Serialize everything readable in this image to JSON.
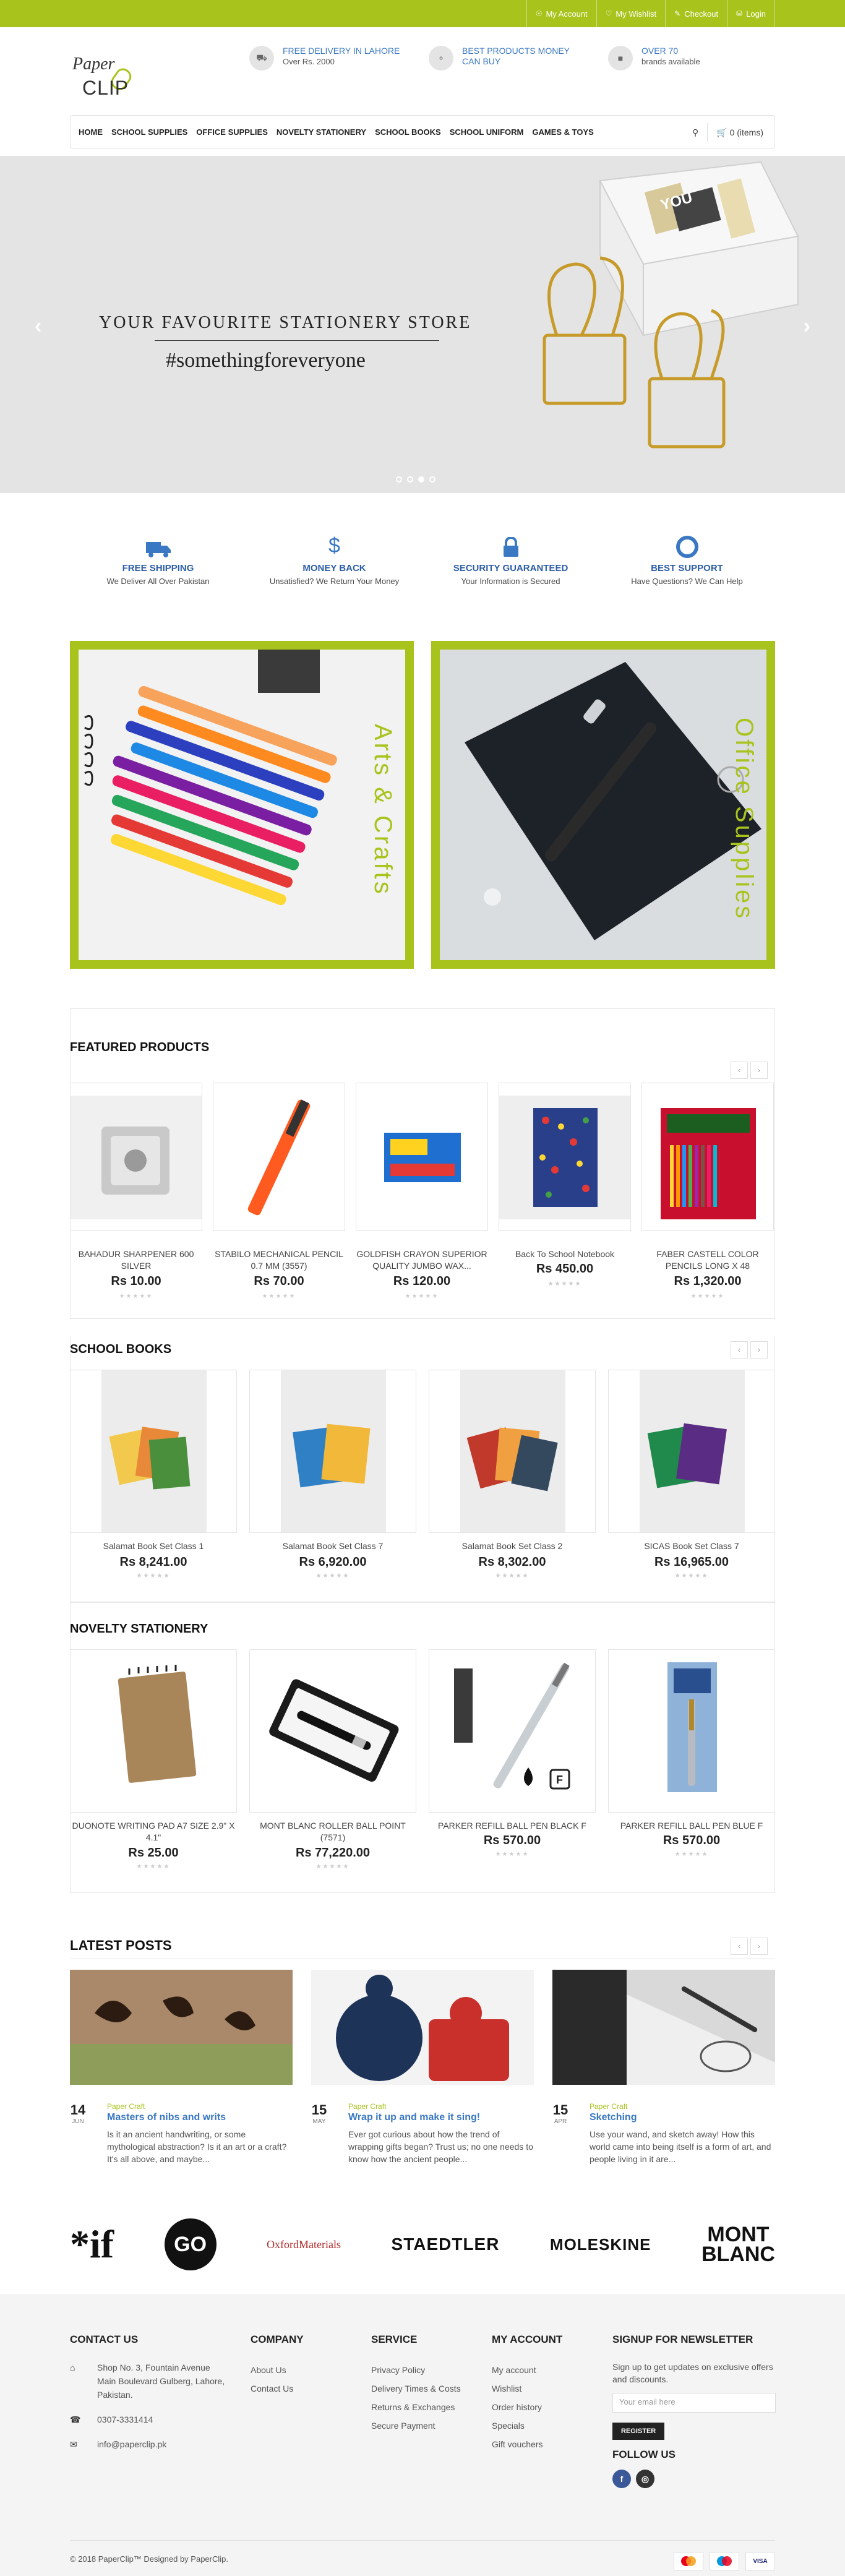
{
  "topbar": {
    "links": [
      {
        "label": "My Account",
        "icon": "user-icon"
      },
      {
        "label": "My Wishlist",
        "icon": "heart-icon"
      },
      {
        "label": "Checkout",
        "icon": "checkout-icon"
      },
      {
        "label": "Login",
        "icon": "lock-icon"
      }
    ]
  },
  "header": {
    "logo": {
      "line1": "Paper",
      "line2": "CLIP"
    },
    "promos": [
      {
        "title": "FREE DELIVERY IN LAHORE",
        "sub": "Over Rs. 2000",
        "icon": "truck-icon"
      },
      {
        "title": "BEST PRODUCTS MONEY CAN BUY",
        "sub": "",
        "icon": "tag-icon"
      },
      {
        "title": "OVER 70",
        "sub": "brands available",
        "icon": "lock-icon"
      }
    ]
  },
  "nav": {
    "items": [
      "HOME",
      "SCHOOL SUPPLIES",
      "OFFICE SUPPLIES",
      "NOVELTY STATIONERY",
      "SCHOOL BOOKS",
      "SCHOOL UNIFORM",
      "GAMES & TOYS"
    ],
    "cart": "0 (items)"
  },
  "hero": {
    "title": "YOUR FAVOURITE STATIONERY STORE",
    "subtitle": "#somethingforeveryone",
    "label": "YOU"
  },
  "features": [
    {
      "title": "FREE SHIPPING",
      "sub": "We Deliver All Over Pakistan",
      "icon": "truck-icon"
    },
    {
      "title": "MONEY BACK",
      "sub": "Unsatisfied? We Return Your Money",
      "icon": "dollar-icon"
    },
    {
      "title": "SECURITY GUARANTEED",
      "sub": "Your Information is Secured",
      "icon": "lock-icon"
    },
    {
      "title": "BEST SUPPORT",
      "sub": "Have Questions? We Can Help",
      "icon": "lifebuoy-icon"
    }
  ],
  "banners": [
    {
      "label": "Arts & Crafts"
    },
    {
      "label": "Office Supplies"
    }
  ],
  "featured": {
    "title": "FEATURED PRODUCTS",
    "items": [
      {
        "name": "BAHADUR SHARPENER 600 SILVER",
        "price": "Rs 10.00"
      },
      {
        "name": "STABILO MECHANICAL PENCIL 0.7 MM (3557)",
        "price": "Rs 70.00"
      },
      {
        "name": "GOLDFISH CRAYON SUPERIOR QUALITY JUMBO WAX...",
        "price": "Rs 120.00"
      },
      {
        "name": "Back To School Notebook",
        "price": "Rs 450.00"
      },
      {
        "name": "FABER CASTELL COLOR PENCILS LONG X 48",
        "price": "Rs 1,320.00"
      }
    ]
  },
  "books": {
    "title": "SCHOOL BOOKS",
    "items": [
      {
        "name": "Salamat Book Set Class 1",
        "price": "Rs 8,241.00"
      },
      {
        "name": "Salamat Book Set Class 7",
        "price": "Rs 6,920.00"
      },
      {
        "name": "Salamat Book Set Class 2",
        "price": "Rs 8,302.00"
      },
      {
        "name": "SICAS Book Set Class 7",
        "price": "Rs 16,965.00"
      }
    ]
  },
  "novelty": {
    "title": "NOVELTY STATIONERY",
    "items": [
      {
        "name": "DUONOTE WRITING PAD A7 SIZE 2.9\" x 4.1\"",
        "price": "Rs 25.00"
      },
      {
        "name": "MONT BLANC ROLLER BALL POINT (7571)",
        "price": "Rs 77,220.00"
      },
      {
        "name": "PARKER REFILL BALL PEN BLACK F",
        "price": "Rs 570.00"
      },
      {
        "name": "PARKER REFILL BALL PEN BLUE F",
        "price": "Rs 570.00"
      }
    ],
    "refill_label": "F"
  },
  "posts": {
    "title": "LATEST POSTS",
    "items": [
      {
        "day": "14",
        "month": "JUN",
        "cat": "Paper Craft",
        "title": "Masters of nibs and writs",
        "excerpt": "Is it an ancient handwriting, or some mythological abstraction? Is it an art or a craft? It's all above, and maybe..."
      },
      {
        "day": "15",
        "month": "MAY",
        "cat": "Paper Craft",
        "title": "Wrap it up and make it sing!",
        "excerpt": "Ever got curious about how the trend of wrapping gifts began? Trust us; no one needs to know how the ancient people..."
      },
      {
        "day": "15",
        "month": "APR",
        "cat": "Paper Craft",
        "title": "Sketching",
        "excerpt": "Use your wand, and sketch away! How this world came into being itself is a form of art, and people living in it are..."
      }
    ]
  },
  "brands": {
    "if": "*if",
    "go": "GO",
    "oxford": "OxfordMaterials",
    "staedtler": "STAEDTLER",
    "moleskine": "MOLESKINE",
    "montblanc_1": "MONT",
    "montblanc_2": "BLANC"
  },
  "footer": {
    "contact": {
      "title": "CONTACT US",
      "address": "Shop No. 3, Fountain Avenue Main Boulevard Gulberg, Lahore, Pakistan.",
      "phone": "0307-3331414",
      "email": "info@paperclip.pk"
    },
    "company": {
      "title": "COMPANY",
      "links": [
        "About Us",
        "Contact Us"
      ]
    },
    "service": {
      "title": "SERVICE",
      "links": [
        "Privacy Policy",
        "Delivery Times & Costs",
        "Returns & Exchanges",
        "Secure Payment"
      ]
    },
    "account": {
      "title": "MY ACCOUNT",
      "links": [
        "My account",
        "Wishlist",
        "Order history",
        "Specials",
        "Gift vouchers"
      ]
    },
    "newsletter": {
      "title": "SIGNUP FOR NEWSLETTER",
      "text": "Sign up to get updates on exclusive offers and discounts.",
      "placeholder": "Your email here",
      "button": "REGISTER",
      "follow": "FOLLOW US"
    },
    "copyright": "© 2018 PaperClip™ Designed by PaperClip.",
    "cards": [
      "MC",
      "MC",
      "VISA"
    ]
  },
  "colors": {
    "accent": "#a8c41c",
    "blue": "#3a78c3"
  }
}
